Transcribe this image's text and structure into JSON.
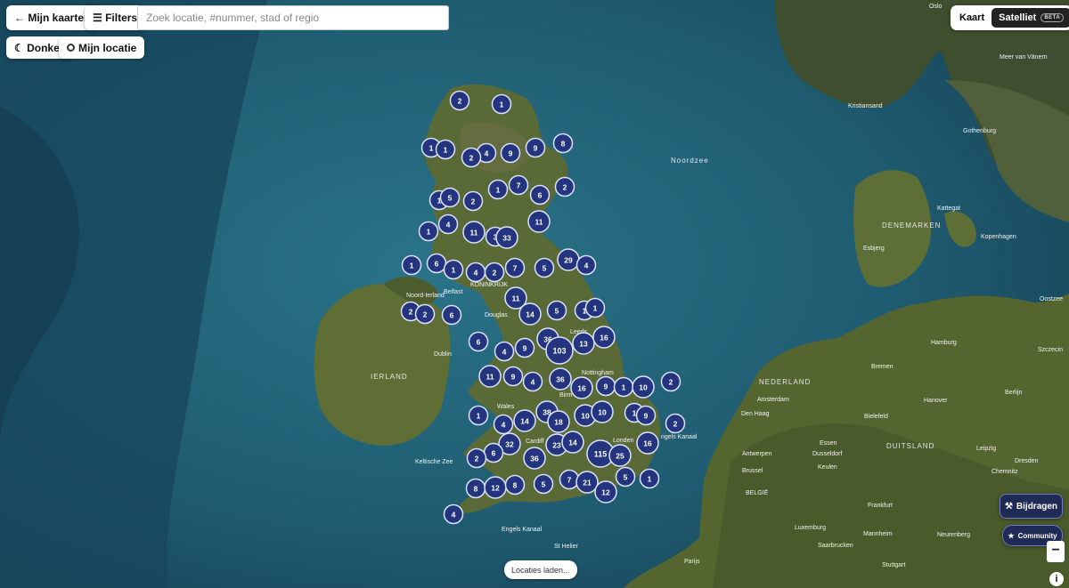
{
  "toolbar": {
    "back_label": "← Mijn kaarten",
    "filters_label": "☰ Filters",
    "search_placeholder": "Zoek locatie, #nummer, stad of regio",
    "dark_label": "☾ Donker",
    "location_label": "Mijn locatie",
    "map_type": {
      "map_label": "Kaart",
      "satellite_label": "Satelliet",
      "beta_label": "BETA",
      "selected": "Satelliet"
    }
  },
  "actions": {
    "contribute_label": "Bijdragen",
    "community_label": "Community",
    "zoom_out_label": "−",
    "info_label": "i"
  },
  "status": {
    "loading_text": "Locaties laden..."
  },
  "colors": {
    "cluster_fill": "#25347e",
    "cluster_border": "#dbe3ff",
    "sea": "#1f5a73",
    "land": "#4a5a2c"
  },
  "map_labels": [
    {
      "id": "oslo",
      "text": "Oslo"
    },
    {
      "id": "meer-van-vanern",
      "text": "Meer van Vänern"
    },
    {
      "id": "kristiansand",
      "text": "Kristiansand"
    },
    {
      "id": "gothenburg",
      "text": "Gothenburg"
    },
    {
      "id": "noordzee",
      "text": "Noordzee"
    },
    {
      "id": "kattegat",
      "text": "Kattegat"
    },
    {
      "id": "denemarken",
      "text": "DENEMARKEN"
    },
    {
      "id": "esbjerg",
      "text": "Esbjerg"
    },
    {
      "id": "kopenhagen",
      "text": "Kopenhagen"
    },
    {
      "id": "oostzee",
      "text": "Oostzee"
    },
    {
      "id": "hamburg",
      "text": "Hamburg"
    },
    {
      "id": "bremen",
      "text": "Bremen"
    },
    {
      "id": "szczecin",
      "text": "Szczecin"
    },
    {
      "id": "berlijn",
      "text": "Berlijn"
    },
    {
      "id": "nederland",
      "text": "NEDERLAND"
    },
    {
      "id": "amsterdam",
      "text": "Amsterdam"
    },
    {
      "id": "den-haag",
      "text": "Den Haag"
    },
    {
      "id": "bielefeld",
      "text": "Bielefeld"
    },
    {
      "id": "hanover",
      "text": "Hanover"
    },
    {
      "id": "duitsland",
      "text": "DUITSLAND"
    },
    {
      "id": "essen",
      "text": "Essen"
    },
    {
      "id": "dusseldorf",
      "text": "Dusseldorf"
    },
    {
      "id": "keulen",
      "text": "Keulen"
    },
    {
      "id": "leipzig",
      "text": "Leipzig"
    },
    {
      "id": "dresden",
      "text": "Dresden"
    },
    {
      "id": "chemnitz",
      "text": "Chemnitz"
    },
    {
      "id": "antwerpen",
      "text": "Antwerpen"
    },
    {
      "id": "brussel",
      "text": "Brussel"
    },
    {
      "id": "belgie",
      "text": "BELGIË"
    },
    {
      "id": "frankfurt",
      "text": "Frankfurt"
    },
    {
      "id": "luxemburg",
      "text": "Luxemburg"
    },
    {
      "id": "mannheim",
      "text": "Mannheim"
    },
    {
      "id": "neurenberg",
      "text": "Neurenberg"
    },
    {
      "id": "saarbrucken",
      "text": "Saarbrucken"
    },
    {
      "id": "stuttgart",
      "text": "Stuttgart"
    },
    {
      "id": "parijs",
      "text": "Parijs"
    },
    {
      "id": "st-helier",
      "text": "St Helier"
    },
    {
      "id": "engels-kanaal",
      "text": "Engels Kanaal"
    },
    {
      "id": "keltische-zee",
      "text": "Keltische Zee"
    },
    {
      "id": "ierland",
      "text": "IERLAND"
    },
    {
      "id": "dublin",
      "text": "Dublin"
    },
    {
      "id": "belfast",
      "text": "Belfast"
    },
    {
      "id": "noord-ierland",
      "text": "Noord-Ierland"
    },
    {
      "id": "douglas",
      "text": "Douglas"
    },
    {
      "id": "koninkrijk",
      "text": "KONINKRIJK"
    },
    {
      "id": "leeds",
      "text": "Leeds"
    },
    {
      "id": "nottingham",
      "text": "Nottingham"
    },
    {
      "id": "birmingham",
      "text": "Birm"
    },
    {
      "id": "wales",
      "text": "Wales"
    },
    {
      "id": "cardiff",
      "text": "Cardiff"
    },
    {
      "id": "londen",
      "text": "Londen"
    },
    {
      "id": "engels-kanaal-east",
      "text": "ngels Kanaal"
    }
  ],
  "clusters": [
    {
      "count": "2"
    },
    {
      "count": "1"
    },
    {
      "count": "1"
    },
    {
      "count": "1"
    },
    {
      "count": "4"
    },
    {
      "count": "2"
    },
    {
      "count": "9"
    },
    {
      "count": "9"
    },
    {
      "count": "8"
    },
    {
      "count": "1"
    },
    {
      "count": "7"
    },
    {
      "count": "6"
    },
    {
      "count": "2"
    },
    {
      "count": "1"
    },
    {
      "count": "5"
    },
    {
      "count": "2"
    },
    {
      "count": "4"
    },
    {
      "count": "11"
    },
    {
      "count": "1"
    },
    {
      "count": "11"
    },
    {
      "count": "3"
    },
    {
      "count": "33"
    },
    {
      "count": "1"
    },
    {
      "count": "6"
    },
    {
      "count": "1"
    },
    {
      "count": "4"
    },
    {
      "count": "2"
    },
    {
      "count": "7"
    },
    {
      "count": "5"
    },
    {
      "count": "29"
    },
    {
      "count": "4"
    },
    {
      "count": "2"
    },
    {
      "count": "2"
    },
    {
      "count": "11"
    },
    {
      "count": "6"
    },
    {
      "count": "14"
    },
    {
      "count": "5"
    },
    {
      "count": "1"
    },
    {
      "count": "1"
    },
    {
      "count": "6"
    },
    {
      "count": "4"
    },
    {
      "count": "9"
    },
    {
      "count": "36"
    },
    {
      "count": "103"
    },
    {
      "count": "13"
    },
    {
      "count": "16"
    },
    {
      "count": "11"
    },
    {
      "count": "9"
    },
    {
      "count": "4"
    },
    {
      "count": "36"
    },
    {
      "count": "16"
    },
    {
      "count": "9"
    },
    {
      "count": "1"
    },
    {
      "count": "10"
    },
    {
      "count": "2"
    },
    {
      "count": "1"
    },
    {
      "count": "4"
    },
    {
      "count": "14"
    },
    {
      "count": "38"
    },
    {
      "count": "18"
    },
    {
      "count": "10"
    },
    {
      "count": "10"
    },
    {
      "count": "1"
    },
    {
      "count": "9"
    },
    {
      "count": "2"
    },
    {
      "count": "32"
    },
    {
      "count": "6"
    },
    {
      "count": "2"
    },
    {
      "count": "36"
    },
    {
      "count": "23"
    },
    {
      "count": "14"
    },
    {
      "count": "115"
    },
    {
      "count": "25"
    },
    {
      "count": "16"
    },
    {
      "count": "8"
    },
    {
      "count": "12"
    },
    {
      "count": "8"
    },
    {
      "count": "5"
    },
    {
      "count": "7"
    },
    {
      "count": "21"
    },
    {
      "count": "12"
    },
    {
      "count": "5"
    },
    {
      "count": "1"
    },
    {
      "count": "4"
    }
  ]
}
